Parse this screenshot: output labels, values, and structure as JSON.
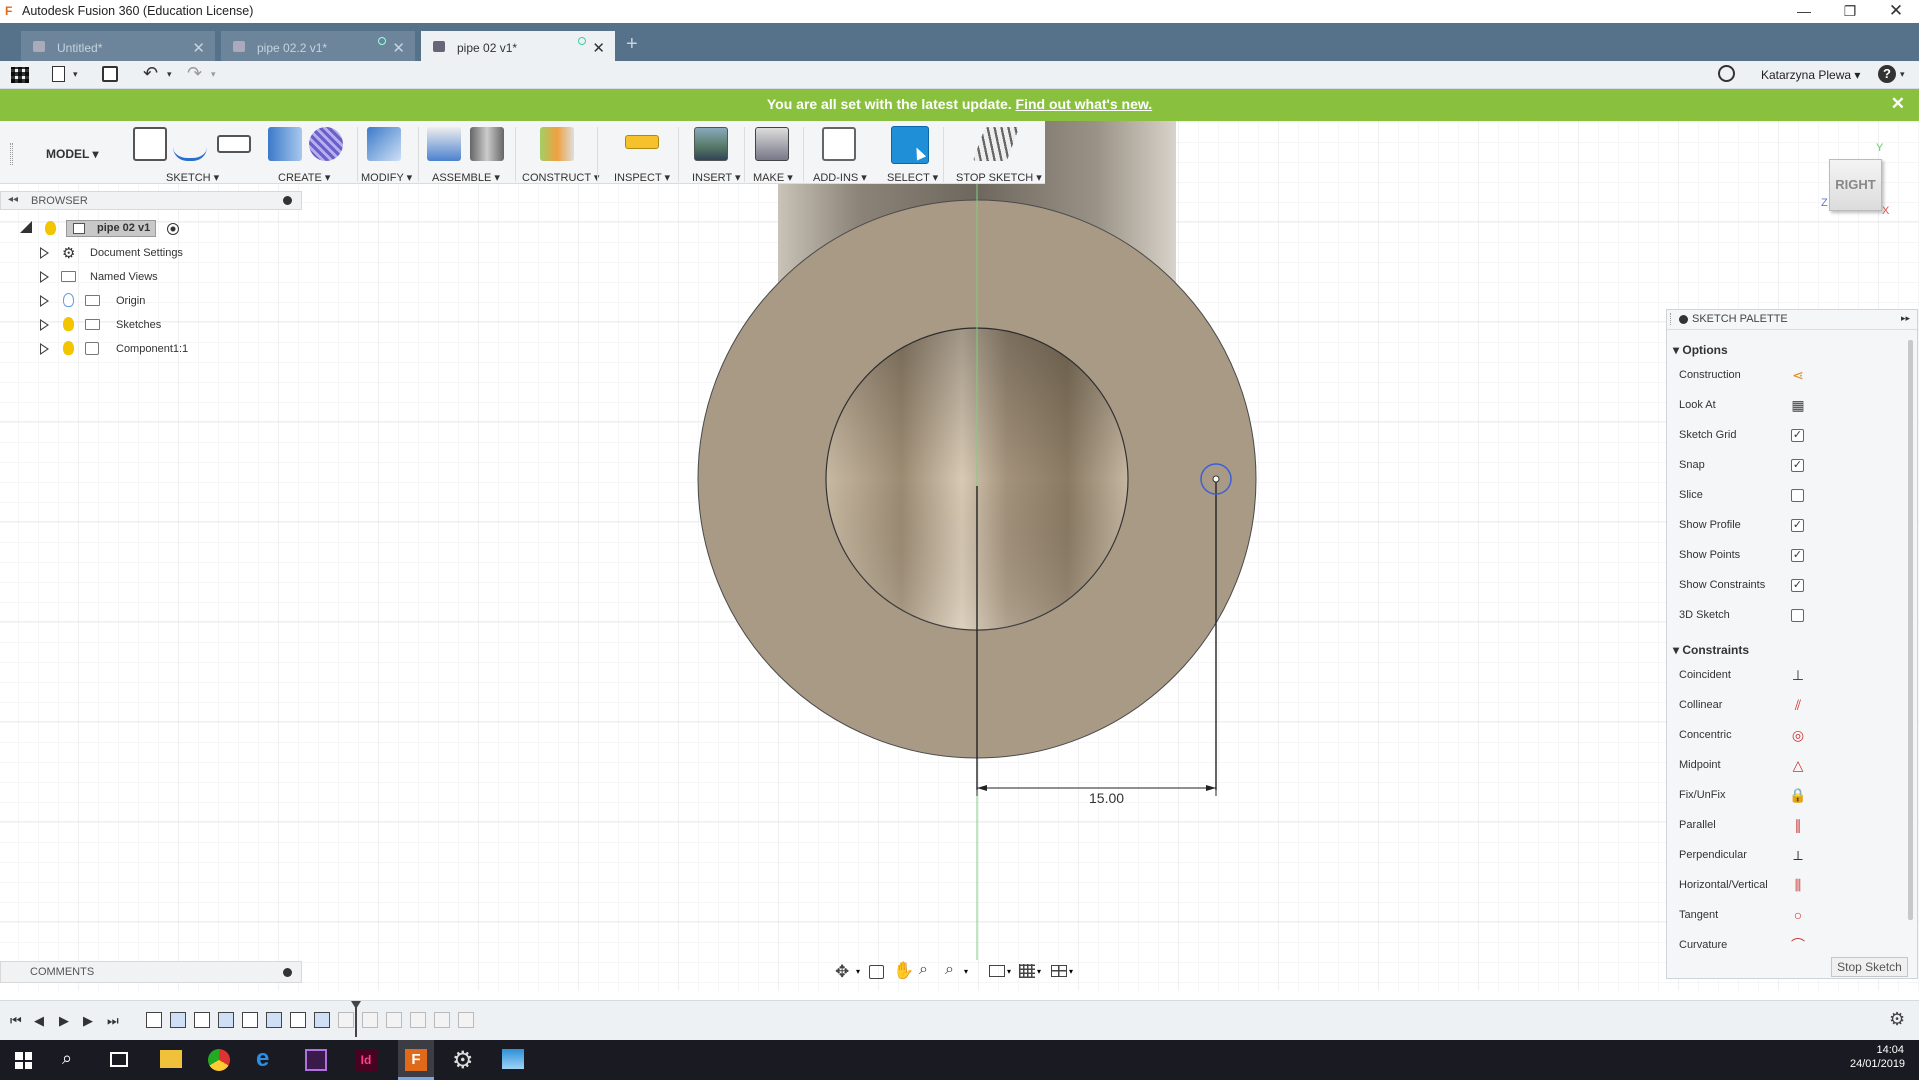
{
  "window": {
    "title": "Autodesk Fusion 360 (Education License)",
    "controls": [
      "minimize",
      "maximize",
      "close"
    ]
  },
  "tabs": [
    {
      "label": "Untitled*",
      "active": false
    },
    {
      "label": "pipe 02.2 v1*",
      "active": false
    },
    {
      "label": "pipe 02 v1*",
      "active": true
    }
  ],
  "quick_access": {
    "user": "Katarzyna Plewa"
  },
  "banner": {
    "text": "You are all set with the latest update.",
    "link": "Find out what's new."
  },
  "ribbon": {
    "workspace": "MODEL",
    "groups": [
      "SKETCH",
      "CREATE",
      "MODIFY",
      "ASSEMBLE",
      "CONSTRUCT",
      "INSPECT",
      "INSERT",
      "MAKE",
      "ADD-INS",
      "SELECT",
      "STOP SKETCH"
    ]
  },
  "browser": {
    "title": "BROWSER",
    "root": "pipe 02 v1",
    "items": [
      "Document Settings",
      "Named Views",
      "Origin",
      "Sketches",
      "Component1:1"
    ]
  },
  "viewcube": {
    "face": "RIGHT",
    "axes": [
      "Y",
      "Z",
      "X"
    ]
  },
  "sketch": {
    "dimension": "15.00"
  },
  "palette": {
    "title": "SKETCH PALETTE",
    "options_title": "Options",
    "options": [
      {
        "label": "Construction",
        "type": "icon",
        "icon": "construction-icon"
      },
      {
        "label": "Look At",
        "type": "icon",
        "icon": "look-at-icon"
      },
      {
        "label": "Sketch Grid",
        "type": "checkbox",
        "checked": true
      },
      {
        "label": "Snap",
        "type": "checkbox",
        "checked": true
      },
      {
        "label": "Slice",
        "type": "checkbox",
        "checked": false
      },
      {
        "label": "Show Profile",
        "type": "checkbox",
        "checked": true
      },
      {
        "label": "Show Points",
        "type": "checkbox",
        "checked": true
      },
      {
        "label": "Show Constraints",
        "type": "checkbox",
        "checked": true
      },
      {
        "label": "3D Sketch",
        "type": "checkbox",
        "checked": false
      }
    ],
    "constraints_title": "Constraints",
    "constraints": [
      {
        "label": "Coincident",
        "glyph": "⊥"
      },
      {
        "label": "Collinear",
        "glyph": "⫽"
      },
      {
        "label": "Concentric",
        "glyph": "◎"
      },
      {
        "label": "Midpoint",
        "glyph": "△"
      },
      {
        "label": "Fix/UnFix",
        "glyph": "🔒"
      },
      {
        "label": "Parallel",
        "glyph": "∥"
      },
      {
        "label": "Perpendicular",
        "glyph": "⟂"
      },
      {
        "label": "Horizontal/Vertical",
        "glyph": "⫼"
      },
      {
        "label": "Tangent",
        "glyph": "○"
      },
      {
        "label": "Curvature",
        "glyph": "⌒"
      }
    ],
    "stop_button": "Stop Sketch"
  },
  "comments": {
    "title": "COMMENTS"
  },
  "taskbar": {
    "time": "14:04",
    "date": "24/01/2019"
  },
  "colors": {
    "tabbar": "#56728a",
    "banner": "#89c13e",
    "body": "#a89a85",
    "select_active": "#1f8fd8",
    "taskbar": "#1a1b22"
  }
}
